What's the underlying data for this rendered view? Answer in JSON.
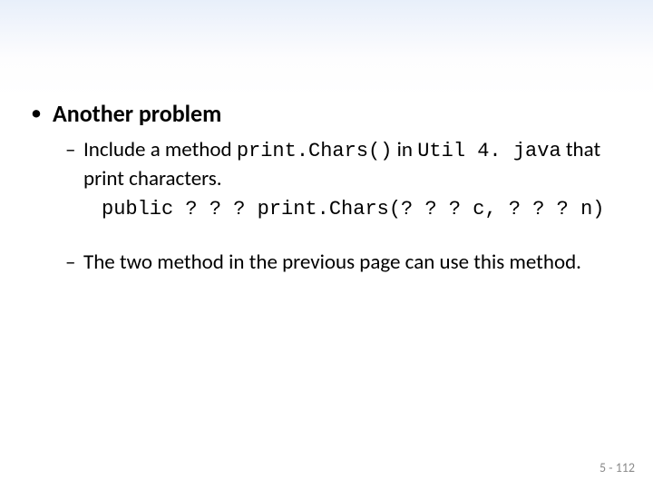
{
  "bullets": {
    "l1": {
      "title": "Another problem"
    },
    "sub1": {
      "prefix": "Include a method ",
      "code1": "print.Chars()",
      "mid": " in ",
      "code2": "Util 4. java",
      "suffix": " that print characters."
    },
    "codeLine": "public ? ? ? print.Chars(? ? ? c, ? ? ? n)",
    "sub2": "The two method in the previous page can use this method."
  },
  "pageNumber": "5 - 112"
}
